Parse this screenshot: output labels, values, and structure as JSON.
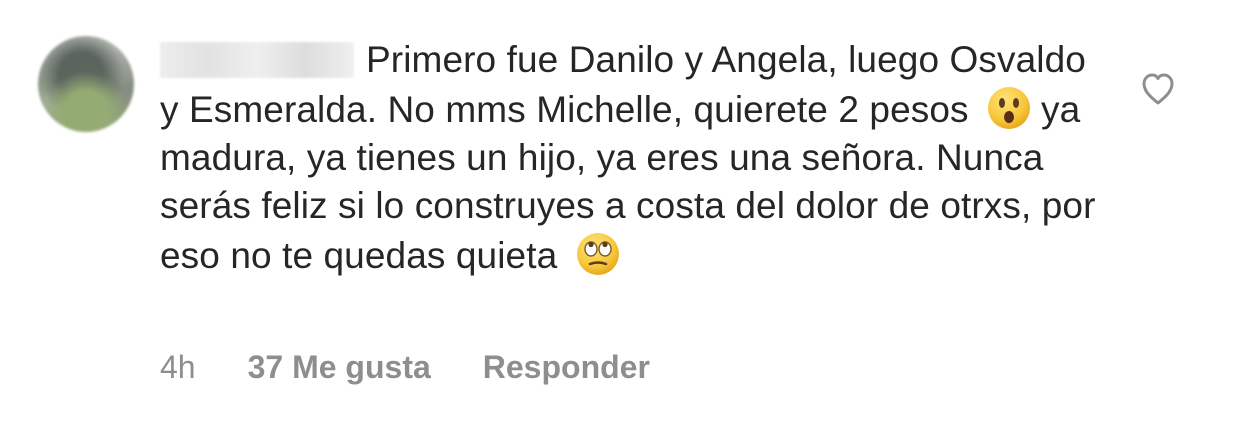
{
  "comment": {
    "author_display": "",
    "text_parts": [
      "Primero fue Danilo y Angela, luego Osvaldo y Esmeralda. No mms Michelle, quierete 2 pesos",
      "ya madura, ya tienes un hijo, ya eres una señora. Nunca serás feliz si lo construyes a costa del dolor de otrxs, por eso no te quedas quieta"
    ],
    "emojis": {
      "first": "face-with-open-mouth-icon",
      "second": "face-with-rolling-eyes-icon"
    },
    "meta": {
      "time": "4h",
      "likes": "37 Me gusta",
      "reply": "Responder"
    }
  },
  "colors": {
    "text": "#262626",
    "muted": "#8e8e8e",
    "emoji_yellow": "#f7c73b"
  }
}
